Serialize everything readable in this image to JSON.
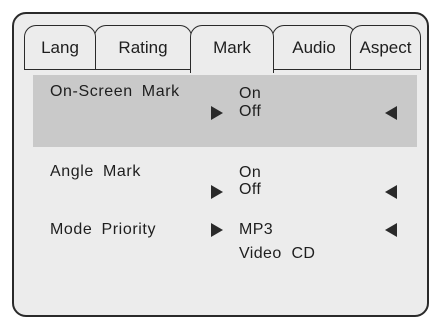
{
  "colors": {
    "panel_bg": "#ececec",
    "selected_row_bg": "#c9c9c9",
    "border": "#2a2a2a",
    "text": "#1e1e1e"
  },
  "tabs": [
    {
      "label": "Lang",
      "active": false
    },
    {
      "label": "Rating",
      "active": false
    },
    {
      "label": "Mark",
      "active": true
    },
    {
      "label": "Audio",
      "active": false
    },
    {
      "label": "Aspect",
      "active": false
    }
  ],
  "settings": [
    {
      "label": "On-Screen  Mark",
      "options": [
        "On",
        "Off"
      ],
      "selected_option": "Off",
      "highlighted": true
    },
    {
      "label": "Angle  Mark",
      "options": [
        "On",
        "Off"
      ],
      "selected_option": "Off",
      "highlighted": false
    },
    {
      "label": "Mode  Priority",
      "options": [
        "MP3",
        "Video  CD"
      ],
      "selected_option": "MP3",
      "highlighted": false
    }
  ],
  "icons": {
    "right_arrow": "triangle-right-icon",
    "left_arrow": "triangle-left-icon"
  }
}
